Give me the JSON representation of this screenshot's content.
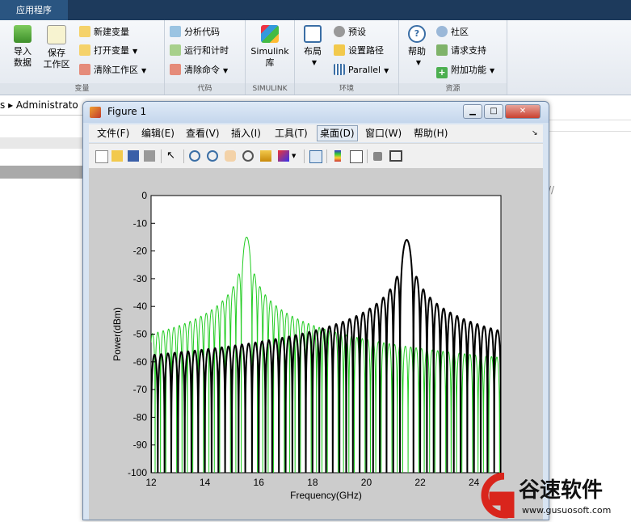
{
  "app_tab": "应用程序",
  "ribbon": {
    "import_data": "导入\n数据",
    "save_workspace": "保存\n工作区",
    "new_variable": "新建变量",
    "open_variable": "打开变量",
    "clear_workspace": "清除工作区",
    "group_variable": "变量",
    "analyze_code": "分析代码",
    "run_and_time": "运行和计时",
    "clear_commands": "清除命令",
    "group_code": "代码",
    "simulink": "Simulink\n库",
    "group_simulink": "SIMULINK",
    "layout": "布局",
    "preferences": "预设",
    "set_path": "设置路径",
    "parallel": "Parallel",
    "group_env": "环境",
    "help": "帮助",
    "community": "社区",
    "request_support": "请求支持",
    "addons": "附加功能",
    "group_resources": "资源"
  },
  "path_bar": "s ▸ Administrato",
  "right_text": "//",
  "figure": {
    "title": "Figure 1",
    "menus": [
      "文件(F)",
      "编辑(E)",
      "查看(V)",
      "插入(I)",
      "工具(T)",
      "桌面(D)",
      "窗口(W)",
      "帮助(H)"
    ]
  },
  "colors": {
    "green_series": "#22cc22",
    "black_series": "#000000",
    "watermark_red": "#d9251c"
  },
  "chart_data": {
    "type": "line",
    "xlabel": "Frequency(GHz)",
    "ylabel": "Power(dBm)",
    "xlim": [
      12,
      25
    ],
    "ylim": [
      -100,
      0
    ],
    "xticks": [
      12,
      14,
      16,
      18,
      20,
      22,
      24
    ],
    "yticks": [
      0,
      -10,
      -20,
      -30,
      -40,
      -50,
      -60,
      -70,
      -80,
      -90,
      -100
    ],
    "grid": false,
    "series": [
      {
        "color": "green",
        "peak_x": 15.55,
        "peak_y": -15,
        "lobe_spacing": 0.2,
        "description": "sinc-shaped spectrum, main lobe ~15.5 GHz"
      },
      {
        "color": "black",
        "peak_x": 21.5,
        "peak_y": -16,
        "lobe_spacing": 0.25,
        "description": "sinc-shaped spectrum, main lobe ~21.5 GHz"
      }
    ]
  },
  "watermark": {
    "text": "谷速软件",
    "url": "www.gusuosoft.com"
  }
}
